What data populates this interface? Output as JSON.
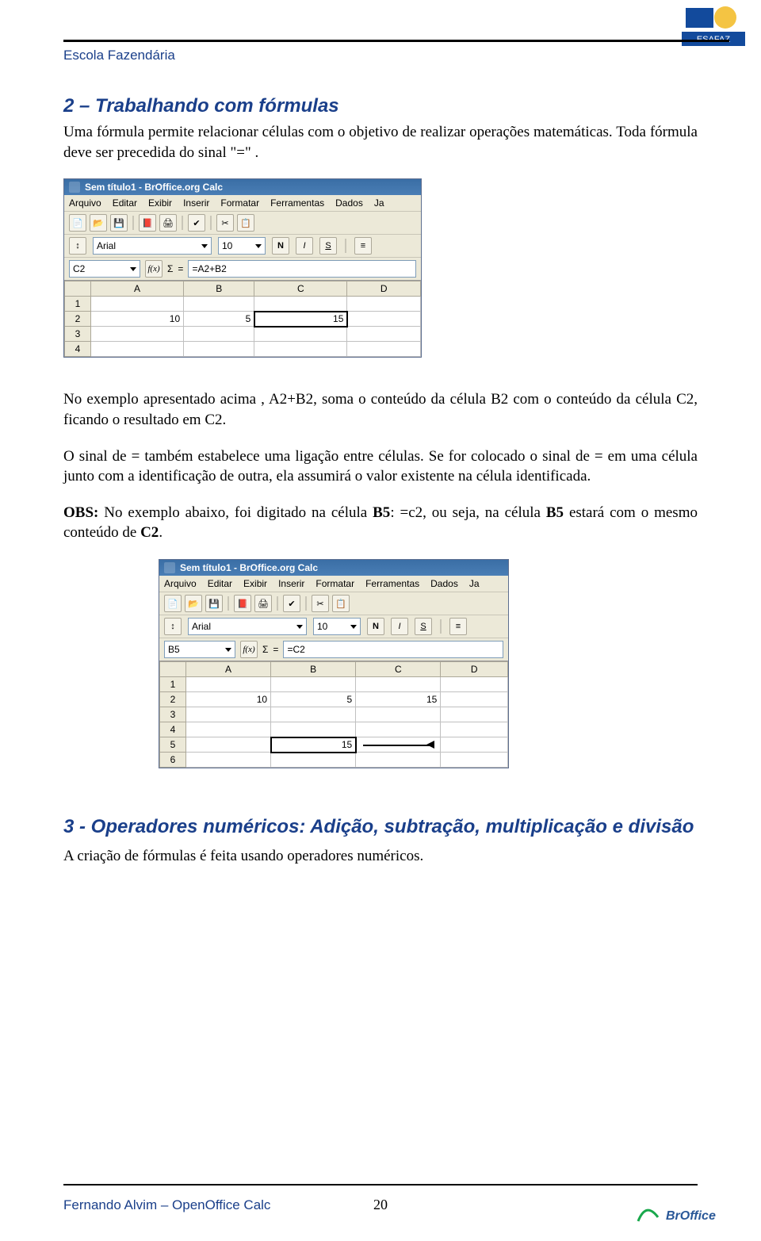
{
  "header": {
    "school_name": "Escola Fazendária",
    "logo_text": "ESAFAZ"
  },
  "section2": {
    "title": "2 – Trabalhando com fórmulas",
    "p1": "Uma fórmula permite relacionar células com o objetivo de realizar operações matemáticas. Toda fórmula deve ser precedida do sinal \"=\" ."
  },
  "screenshot1": {
    "window_title": "Sem título1 - BrOffice.org Calc",
    "menu": [
      "Arquivo",
      "Editar",
      "Exibir",
      "Inserir",
      "Formatar",
      "Ferramentas",
      "Dados",
      "Ja"
    ],
    "font_name": "Arial",
    "font_size": "10",
    "cell_ref": "C2",
    "formula": "=A2+B2",
    "columns": [
      "A",
      "B",
      "C",
      "D"
    ],
    "rows": [
      "1",
      "2",
      "3",
      "4"
    ],
    "values": {
      "A2": "10",
      "B2": "5",
      "C2": "15"
    }
  },
  "between": {
    "p2": "No exemplo apresentado acima , A2+B2, soma o conteúdo da célula B2 com o conteúdo da célula C2, ficando o resultado em C2.",
    "p3": "O sinal de = também estabelece uma ligação entre células. Se for colocado o sinal de = em uma célula junto com a identificação de outra, ela assumirá o valor existente na célula identificada.",
    "obs_label": "OBS:",
    "obs_text1": " No exemplo abaixo, foi digitado na célula ",
    "b5": "B5",
    "colon_eq": ": =c2",
    "obs_text2": ", ou seja, na célula ",
    "obs_text3": " estará com o mesmo conteúdo de ",
    "c2": "C2",
    "period": "."
  },
  "screenshot2": {
    "window_title": "Sem título1 - BrOffice.org Calc",
    "menu": [
      "Arquivo",
      "Editar",
      "Exibir",
      "Inserir",
      "Formatar",
      "Ferramentas",
      "Dados",
      "Ja"
    ],
    "font_name": "Arial",
    "font_size": "10",
    "cell_ref": "B5",
    "formula": "=C2",
    "columns": [
      "A",
      "B",
      "C",
      "D"
    ],
    "rows": [
      "1",
      "2",
      "3",
      "4",
      "5",
      "6"
    ],
    "values": {
      "A2": "10",
      "B2": "5",
      "C2": "15",
      "B5": "15"
    }
  },
  "section3": {
    "title": "3 - Operadores numéricos: Adição, subtração, multiplicação e divisão",
    "p1": "A criação de fórmulas é feita usando operadores numéricos."
  },
  "footer": {
    "left": "Fernando Alvim – OpenOffice Calc",
    "page": "20",
    "right": "BrOffice"
  },
  "labels": {
    "fx": "f(x)",
    "sigma": "Σ",
    "eq": "=",
    "bold": "N",
    "italic": "I",
    "underline": "S"
  }
}
